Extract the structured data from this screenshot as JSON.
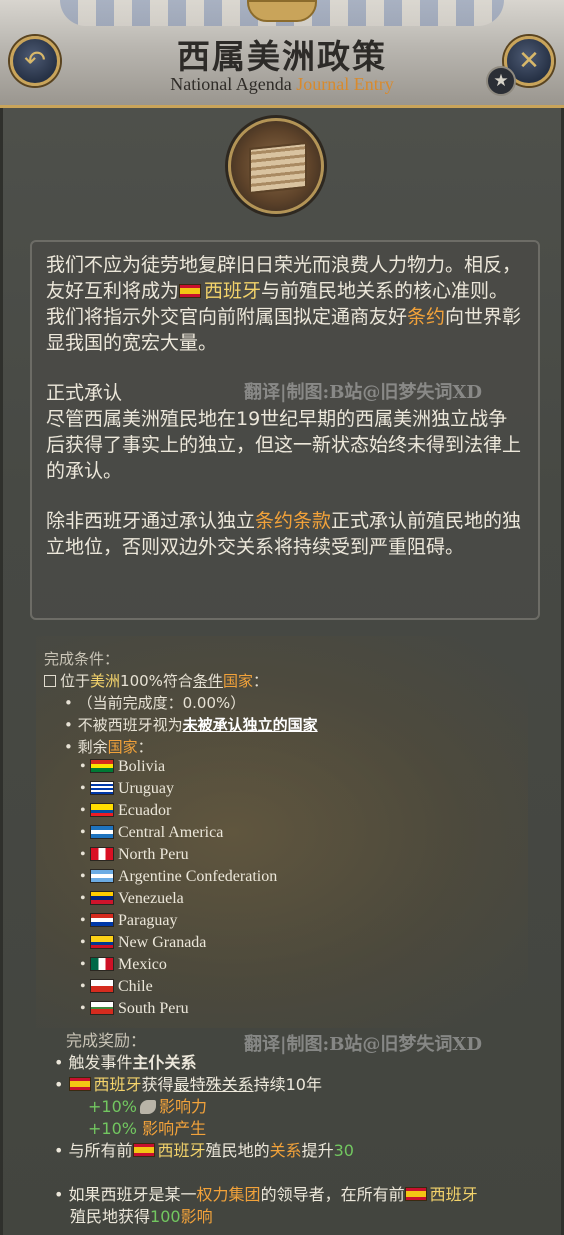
{
  "header": {
    "title": "西属美洲政策",
    "subtitle_prefix": "National Agenda ",
    "subtitle_accent": "Journal Entry",
    "back_icon": "↶",
    "close_icon": "✕",
    "favorite_icon": "★"
  },
  "description": {
    "p1_a": "我们不应为徒劳地复辟旧日荣光而浪费人力物力。相反，友好互利将成为",
    "p1_spain": "西班牙",
    "p1_b": "与前殖民地关系的核心准则。我们将指示外交官向前附属国拟定通商友好",
    "p1_treaty": "条约",
    "p1_c": "向世界彰显我国的宽宏大量。",
    "heading": "正式承认",
    "p2": "尽管西属美洲殖民地在19世纪早期的西属美洲独立战争后获得了事实上的独立，但这一新状态始终未得到法律上的承认。",
    "p3_a": "除非西班牙通过承认独立",
    "p3_terms": "条约条款",
    "p3_b": "正式承认前殖民地的独立地位，否则双边外交关系将持续受到严重阻碍。",
    "watermark": "翻译|制图:B站@旧梦失词XD"
  },
  "conditions": {
    "label": "完成条件：",
    "line1_a": "位于",
    "line1_region": "美洲",
    "line1_b": "100%符合",
    "line1_cond": "条件",
    "line1_country": "国家",
    "line1_c": "：",
    "progress": "（当前完成度：0.00%）",
    "bullet2_a": "不被西班牙视为",
    "bullet2_b": "未被承认独立的国家",
    "bullet3_a": "剩余",
    "bullet3_country": "国家",
    "bullet3_b": "：",
    "countries": [
      "Bolivia",
      "Uruguay",
      "Ecuador",
      "Central America",
      "North Peru",
      "Argentine Confederation",
      "Venezuela",
      "Paraguay",
      "New Granada",
      "Mexico",
      "Chile",
      "South Peru"
    ]
  },
  "rewards": {
    "label": "完成奖励：",
    "r1_a": "触发事件",
    "r1_b": "主仆关系",
    "r2_spain": "西班牙",
    "r2_a": "获得",
    "r2_b": "最特殊关系",
    "r2_c": "持续10年",
    "r2_influence_pct": "+10%",
    "r2_influence": "影响力",
    "r2_gen_pct": "+10%",
    "r2_gen": "影响产生",
    "r3_a": "与所有前",
    "r3_spain": "西班牙",
    "r3_b": "殖民地的",
    "r3_rel": "关系",
    "r3_c": "提升",
    "r3_val": "30",
    "r4_a": "如果西班牙是某一",
    "r4_pg": "权力集团",
    "r4_b": "的领导者，在所有前",
    "r4_spain": "西班牙",
    "r4_c": "殖民地获得",
    "r4_val": "100",
    "r4_inf": "影响",
    "watermark": "翻译|制图:B站@旧梦失词XD"
  }
}
